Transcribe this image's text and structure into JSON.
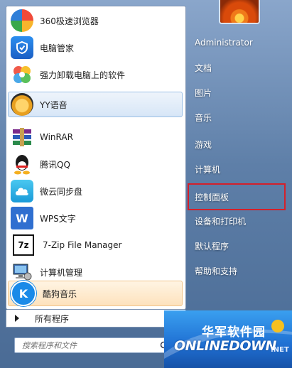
{
  "programs": [
    {
      "label": "360极速浏览器",
      "icon": "360-browser-icon"
    },
    {
      "label": "电脑管家",
      "icon": "pc-manager-icon"
    },
    {
      "label": "强力卸载电脑上的软件",
      "icon": "uninstaller-icon"
    },
    {
      "label": "YY语音",
      "icon": "yy-voice-icon"
    },
    {
      "label": "WinRAR",
      "icon": "winrar-icon"
    },
    {
      "label": "腾讯QQ",
      "icon": "qq-icon"
    },
    {
      "label": "微云同步盘",
      "icon": "weiyun-icon"
    },
    {
      "label": "WPS文字",
      "icon": "wps-icon"
    },
    {
      "label": "7-Zip File Manager",
      "icon": "7zip-icon"
    },
    {
      "label": "计算机管理",
      "icon": "computer-management-icon"
    },
    {
      "label": "酷狗音乐",
      "icon": "kugou-icon"
    }
  ],
  "all_programs": "所有程序",
  "search": {
    "placeholder": "搜索程序和文件"
  },
  "right_menu": [
    "Administrator",
    "文档",
    "图片",
    "音乐",
    "游戏",
    "计算机",
    "控制面板",
    "设备和打印机",
    "默认程序",
    "帮助和支持"
  ],
  "watermark": {
    "cn": "华军软件园",
    "en": "ONLINEDOWN",
    "suffix": ".NET"
  },
  "colors": {
    "highlight": "#d4202a",
    "hover_blue": "#d7e6f7",
    "hover_orange": "#fde2bd"
  }
}
